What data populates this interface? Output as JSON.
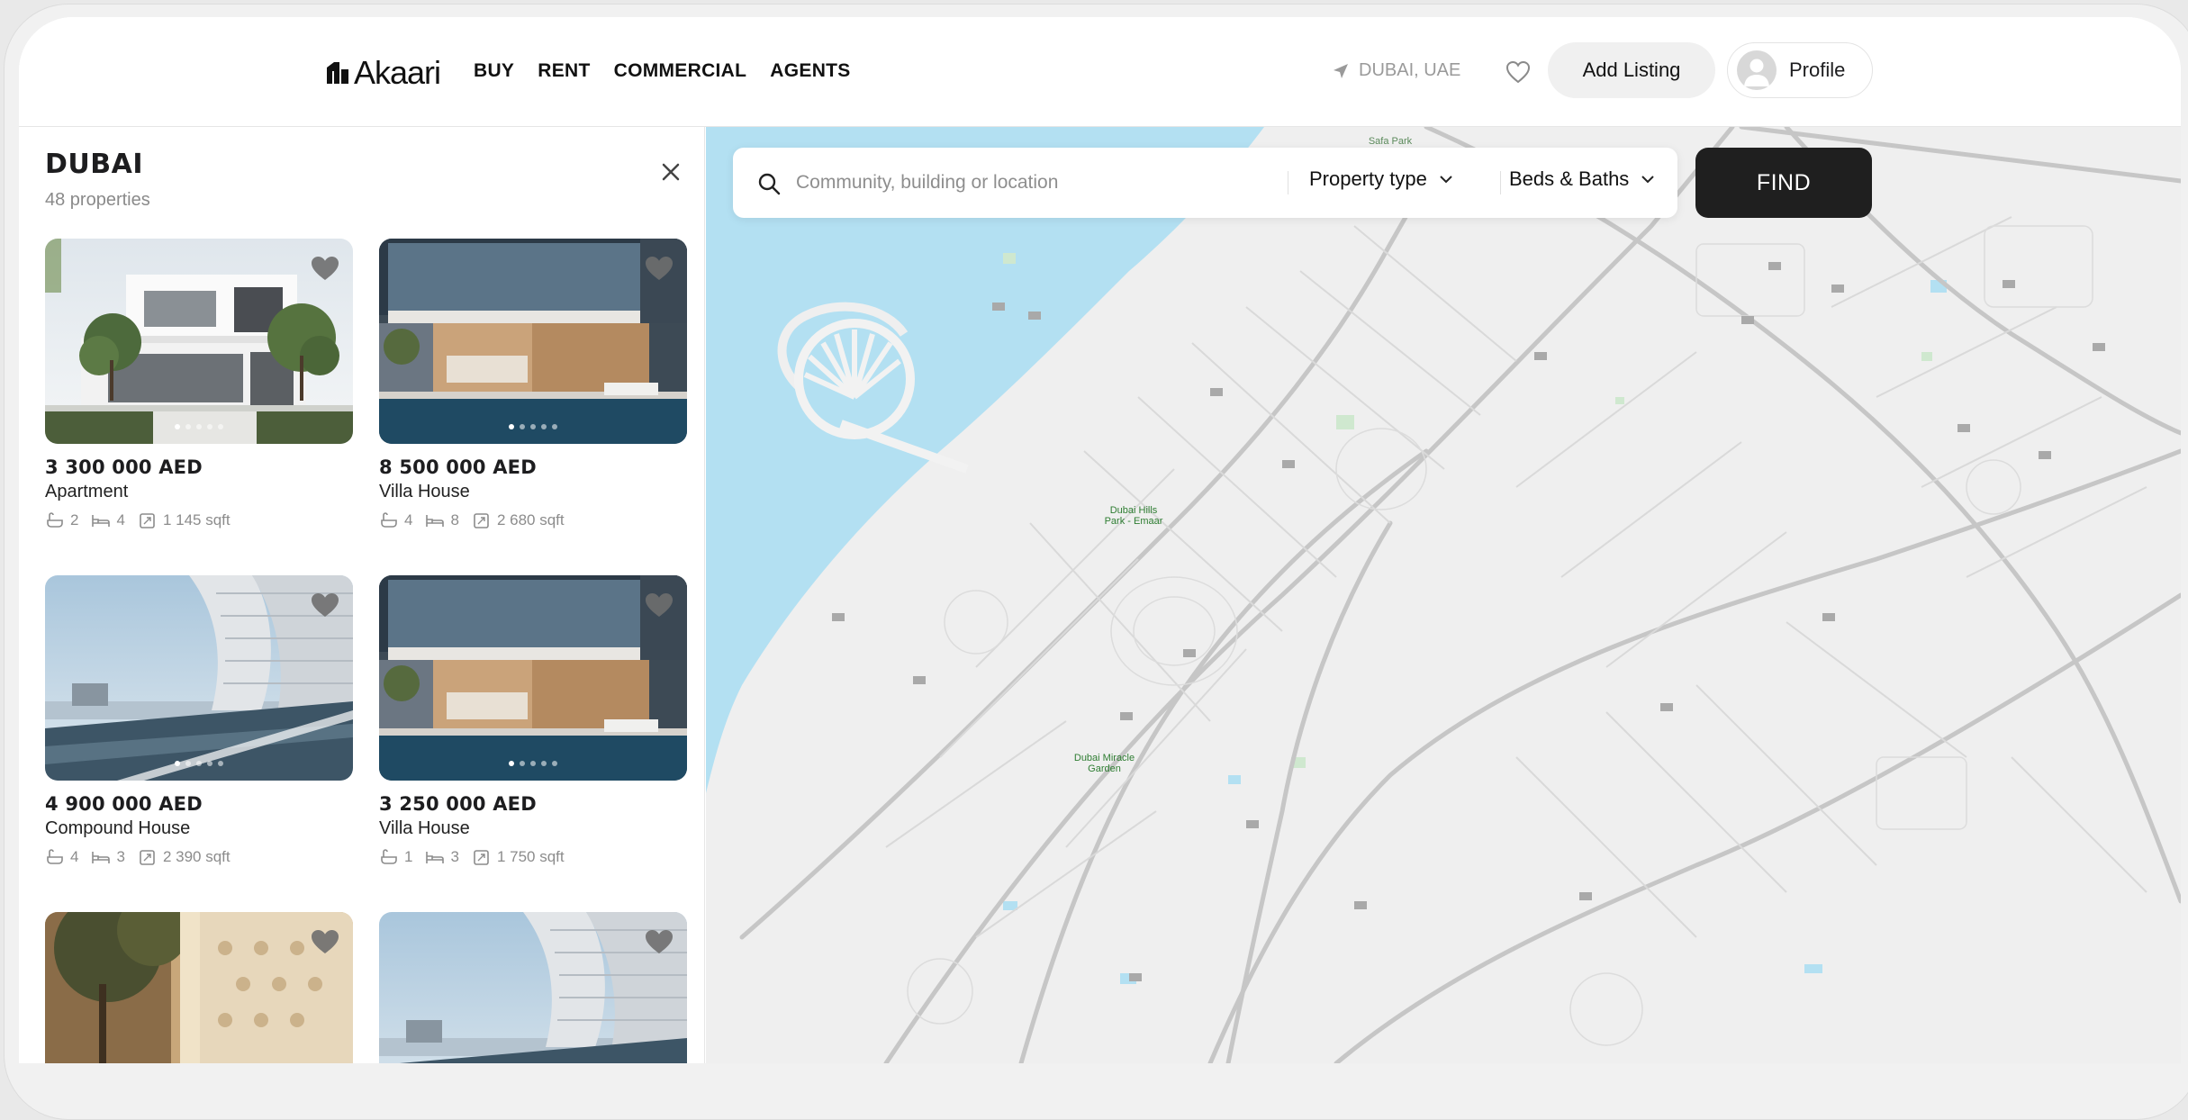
{
  "header": {
    "logo_text": "Akaari",
    "nav": [
      "BUY",
      "RENT",
      "COMMERCIAL",
      "AGENTS"
    ],
    "location": "DUBAI, UAE",
    "add_listing": "Add Listing",
    "profile": "Profile"
  },
  "panel": {
    "title": "DUBAI",
    "count": "48 properties"
  },
  "cards": [
    {
      "price": "3 300 000 AED",
      "type": "Apartment",
      "baths": "2",
      "beds": "4",
      "area": "1 145 sqft"
    },
    {
      "price": "8 500 000 AED",
      "type": "Villa House",
      "baths": "4",
      "beds": "8",
      "area": "2 680 sqft"
    },
    {
      "price": "4 900 000 AED",
      "type": "Compound House",
      "baths": "4",
      "beds": "3",
      "area": "2 390 sqft"
    },
    {
      "price": "3 250 000 AED",
      "type": "Villa House",
      "baths": "1",
      "beds": "3",
      "area": "1 750 sqft"
    }
  ],
  "search": {
    "placeholder": "Community, building or location",
    "property_type": "Property type",
    "beds_baths": "Beds & Baths",
    "find": "FIND"
  },
  "map": {
    "labels": {
      "park1": "Dubai Hills Park - Emaar",
      "park2": "Dubai Miracle Garden",
      "park3": "Safa Park"
    }
  },
  "colors": {
    "accent_dark": "#1f1f1f",
    "water": "#b3e0f2",
    "map_bg": "#efefef",
    "road": "#c9c9c9"
  }
}
